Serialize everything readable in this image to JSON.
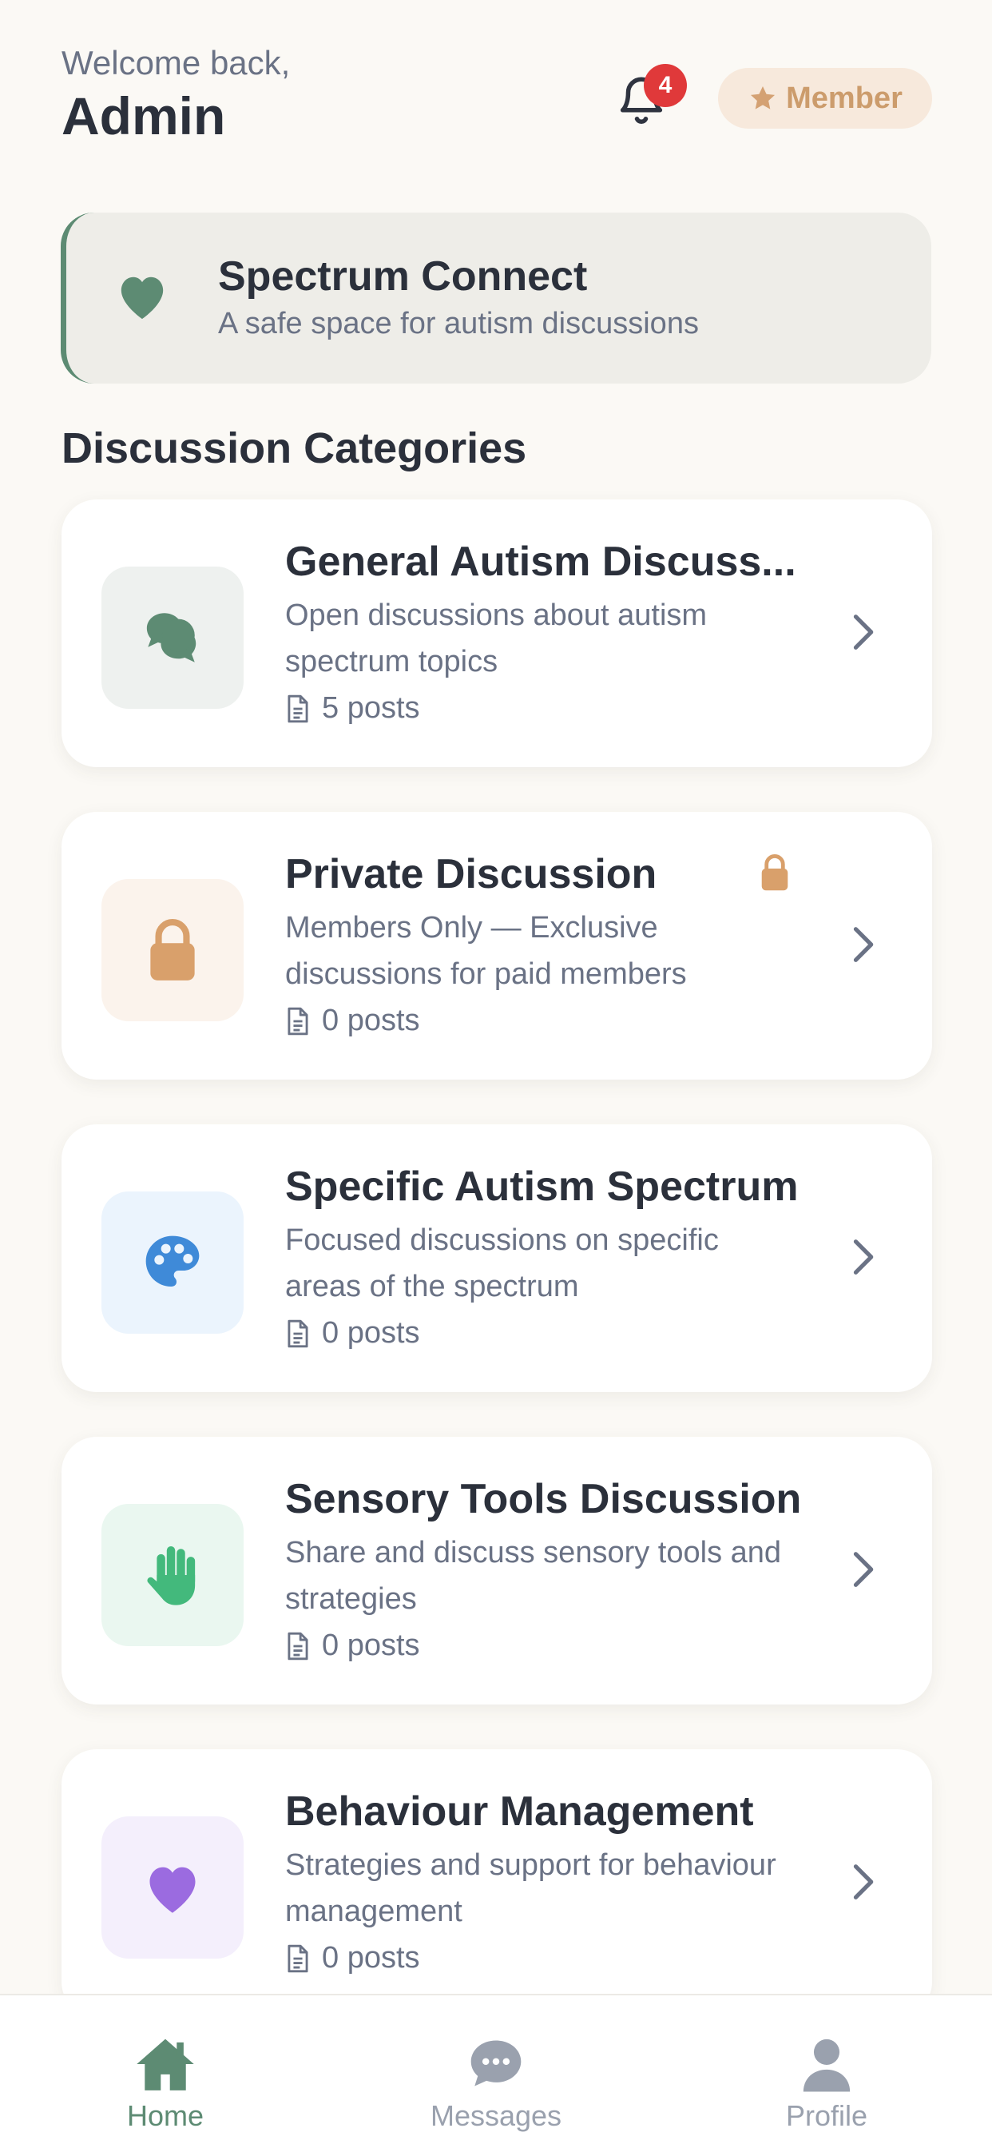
{
  "header": {
    "greeting": "Welcome back,",
    "username": "Admin",
    "notification_count": "4",
    "member_label": "Member"
  },
  "banner": {
    "title": "Spectrum Connect",
    "subtitle": "A safe space for autism discussions"
  },
  "section_title": "Discussion Categories",
  "categories": [
    {
      "title": "General Autism Discuss...",
      "description": "Open discussions about autism spectrum topics",
      "posts": "5 posts",
      "icon": "chat-bubbles-icon",
      "icon_color": "#5d8b73",
      "icon_bg": "#eef1ef"
    },
    {
      "title": "Private Discussion",
      "description": "Members Only — Exclusive discussions for paid members",
      "posts": "0 posts",
      "icon": "lock-icon",
      "icon_color": "#d9a06b",
      "icon_bg": "#fbf3ec",
      "locked": true
    },
    {
      "title": "Specific Autism Spectrum",
      "description": "Focused discussions on specific areas of the spectrum",
      "posts": "0 posts",
      "icon": "palette-icon",
      "icon_color": "#3f8ad8",
      "icon_bg": "#ebf4fd"
    },
    {
      "title": "Sensory Tools Discussion",
      "description": "Share and discuss sensory tools and strategies",
      "posts": "0 posts",
      "icon": "hand-icon",
      "icon_color": "#43b97c",
      "icon_bg": "#eaf7f0"
    },
    {
      "title": "Behaviour Management",
      "description": "Strategies and support for behaviour management",
      "posts": "0 posts",
      "icon": "heart-icon",
      "icon_color": "#9b6be0",
      "icon_bg": "#f4effc"
    }
  ],
  "nav": [
    {
      "label": "Home",
      "icon": "home-icon",
      "active": true
    },
    {
      "label": "Messages",
      "icon": "messages-icon",
      "active": false
    },
    {
      "label": "Profile",
      "icon": "profile-icon",
      "active": false
    }
  ],
  "colors": {
    "accent": "#5d8b73",
    "background": "#fbf9f5",
    "badge_red": "#e0393a",
    "member_gold": "#cc9c6c",
    "inactive_nav": "#9aa1ae"
  }
}
